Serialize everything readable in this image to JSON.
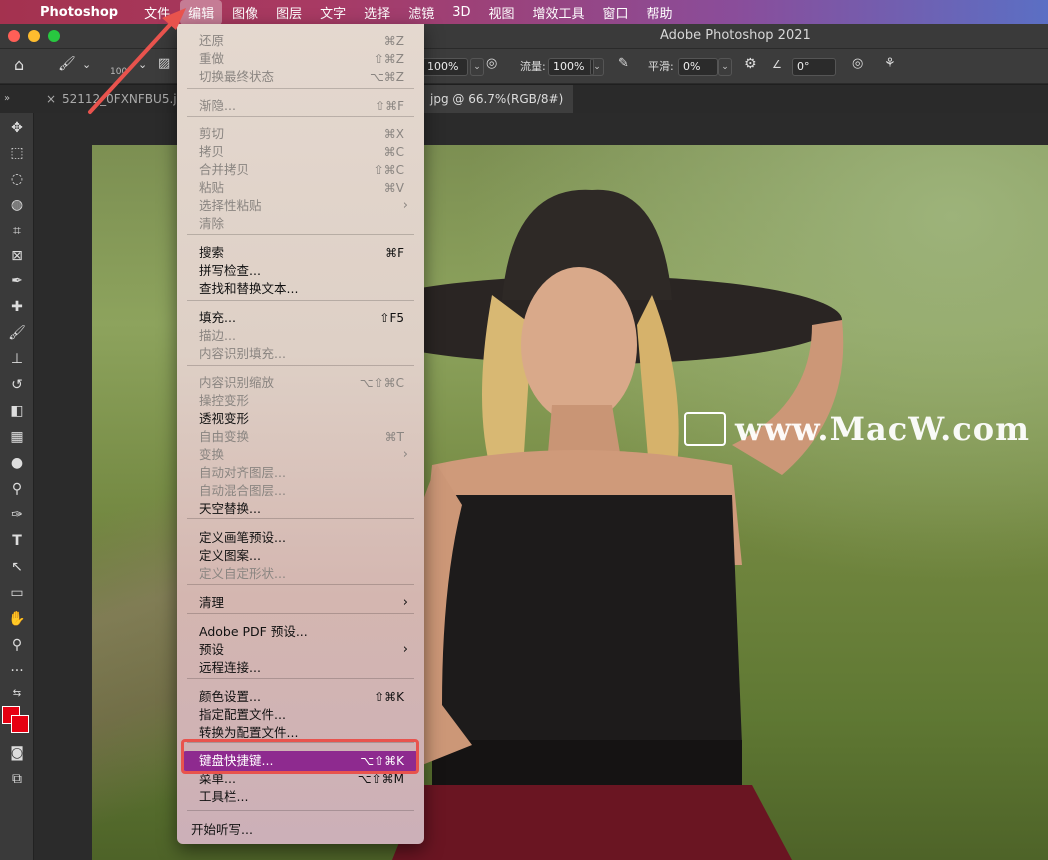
{
  "menubar": {
    "app": "Photoshop",
    "items": [
      "文件",
      "编辑",
      "图像",
      "图层",
      "文字",
      "选择",
      "滤镜",
      "3D",
      "视图",
      "增效工具",
      "窗口",
      "帮助"
    ]
  },
  "window": {
    "title": "Adobe Photoshop 2021"
  },
  "options": {
    "size_fragment": "100",
    "opacity_value": "100%",
    "flow_label": "流量:",
    "flow_value": "100%",
    "smooth_label": "平滑:",
    "smooth_value": "0%",
    "angle_value": "0°"
  },
  "tabs": {
    "tab1": "52112_0FXNFBU5.jpg",
    "tab2": "jpg @ 66.7%(RGB/8#)"
  },
  "watermark": "www.MacW.com",
  "colors": {
    "foreground": "#e60012",
    "background": "#e60012",
    "highlight": "#8e2a8f",
    "annotation": "#e8534d"
  },
  "edit_menu": {
    "items": [
      {
        "label": "还原",
        "shortcut": "⌘Z",
        "disabled": true
      },
      {
        "label": "重做",
        "shortcut": "⇧⌘Z",
        "disabled": true
      },
      {
        "label": "切换最终状态",
        "shortcut": "⌥⌘Z",
        "disabled": true
      },
      {
        "label": "渐隐...",
        "shortcut": "⇧⌘F",
        "disabled": true
      },
      {
        "label": "剪切",
        "shortcut": "⌘X",
        "disabled": true
      },
      {
        "label": "拷贝",
        "shortcut": "⌘C",
        "disabled": true
      },
      {
        "label": "合并拷贝",
        "shortcut": "⇧⌘C",
        "disabled": true
      },
      {
        "label": "粘贴",
        "shortcut": "⌘V",
        "disabled": true
      },
      {
        "label": "选择性粘贴",
        "shortcut": "›",
        "disabled": true
      },
      {
        "label": "清除",
        "shortcut": "",
        "disabled": true
      },
      {
        "label": "搜索",
        "shortcut": "⌘F",
        "disabled": false
      },
      {
        "label": "拼写检查...",
        "shortcut": "",
        "disabled": false
      },
      {
        "label": "查找和替换文本...",
        "shortcut": "",
        "disabled": false
      },
      {
        "label": "填充...",
        "shortcut": "⇧F5",
        "disabled": false
      },
      {
        "label": "描边...",
        "shortcut": "",
        "disabled": true
      },
      {
        "label": "内容识别填充...",
        "shortcut": "",
        "disabled": true
      },
      {
        "label": "内容识别缩放",
        "shortcut": "⌥⇧⌘C",
        "disabled": true
      },
      {
        "label": "操控变形",
        "shortcut": "",
        "disabled": true
      },
      {
        "label": "透视变形",
        "shortcut": "",
        "disabled": false
      },
      {
        "label": "自由变换",
        "shortcut": "⌘T",
        "disabled": true
      },
      {
        "label": "变换",
        "shortcut": "›",
        "disabled": true
      },
      {
        "label": "自动对齐图层...",
        "shortcut": "",
        "disabled": true
      },
      {
        "label": "自动混合图层...",
        "shortcut": "",
        "disabled": true
      },
      {
        "label": "天空替换...",
        "shortcut": "",
        "disabled": false
      },
      {
        "label": "定义画笔预设...",
        "shortcut": "",
        "disabled": false
      },
      {
        "label": "定义图案...",
        "shortcut": "",
        "disabled": false
      },
      {
        "label": "定义自定形状...",
        "shortcut": "",
        "disabled": true
      },
      {
        "label": "清理",
        "shortcut": "›",
        "disabled": false
      },
      {
        "label": "Adobe PDF 预设...",
        "shortcut": "",
        "disabled": false
      },
      {
        "label": "预设",
        "shortcut": "›",
        "disabled": false
      },
      {
        "label": "远程连接...",
        "shortcut": "",
        "disabled": false
      },
      {
        "label": "颜色设置...",
        "shortcut": "⇧⌘K",
        "disabled": false
      },
      {
        "label": "指定配置文件...",
        "shortcut": "",
        "disabled": false
      },
      {
        "label": "转换为配置文件...",
        "shortcut": "",
        "disabled": false
      },
      {
        "label": "键盘快捷键...",
        "shortcut": "⌥⇧⌘K",
        "disabled": false
      },
      {
        "label": "菜单...",
        "shortcut": "⌥⇧⌘M",
        "disabled": false
      },
      {
        "label": "工具栏...",
        "shortcut": "",
        "disabled": false
      },
      {
        "label": "开始听写...",
        "shortcut": "",
        "disabled": false
      }
    ]
  }
}
